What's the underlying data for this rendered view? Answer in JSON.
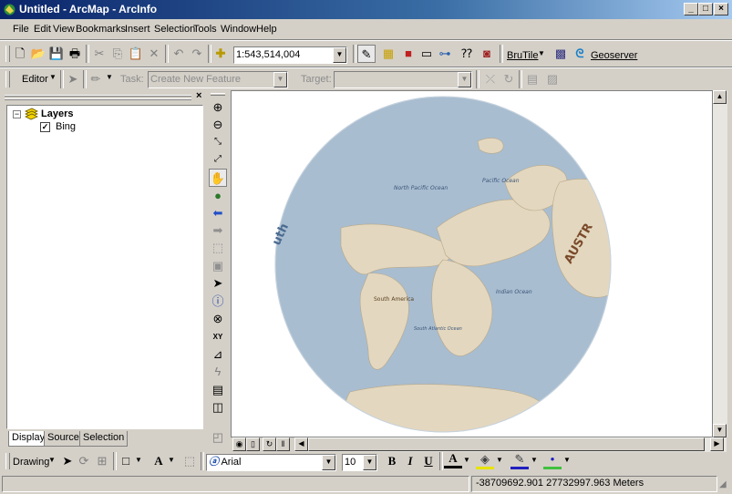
{
  "window": {
    "title": "Untitled - ArcMap - ArcInfo"
  },
  "menu": [
    "File",
    "Edit",
    "View",
    "Bookmarks",
    "Insert",
    "Selection",
    "Tools",
    "Window",
    "Help"
  ],
  "standard_toolbar": {
    "scale": "1:543,514,004",
    "brutile_label": "BruTile",
    "geoserver_label": "Geoserver"
  },
  "editor_toolbar": {
    "editor_label": "Editor",
    "task_label": "Task:",
    "task_value": "Create New Feature",
    "target_label": "Target:",
    "target_value": ""
  },
  "toc": {
    "root_label": "Layers",
    "layers": [
      {
        "name": "Bing",
        "checked": true
      }
    ],
    "tabs": [
      "Display",
      "Source",
      "Selection"
    ],
    "active_tab": "Display"
  },
  "map": {
    "labels": {
      "north_pacific": "North Pacific Ocean",
      "pacific": "Pacific Ocean",
      "indian": "Indian Ocean",
      "south_atlantic": "South Atlantic Ocean",
      "south_america": "South America",
      "australia": "AUSTR",
      "south_edge": "uth"
    },
    "colors": {
      "ocean": "#a8bdd0",
      "land": "#e3d7bf",
      "background": "#ffffff"
    }
  },
  "drawing_toolbar": {
    "drawing_label": "Drawing",
    "font": "Arial",
    "font_size": "10",
    "bold": "B",
    "italic": "I",
    "underline": "U",
    "font_color_letter": "A"
  },
  "status": {
    "coordinates": "-38709692.901  27732997.963 Meters"
  }
}
